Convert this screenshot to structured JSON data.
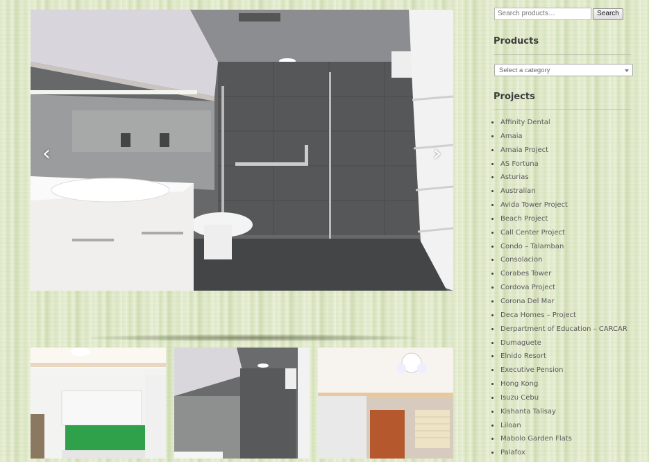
{
  "search": {
    "placeholder": "Search products…",
    "button_label": "Search"
  },
  "products_widget": {
    "title": "Products",
    "select_placeholder": "Select a category"
  },
  "projects_widget": {
    "title": "Projects",
    "items": [
      "Affinity Dental",
      "Amaia",
      "Amaia Project",
      "AS Fortuna",
      "Asturias",
      "Australian",
      "Avida Tower Project",
      "Beach Project",
      "Call Center Project",
      "Condo – Talamban",
      "Consolacion",
      "Corabes Tower",
      "Cordova Project",
      "Corona Del Mar",
      "Deca Homes – Project",
      "Derpartment of Education – CARCAR",
      "Dumaguete",
      "Elnido Resort",
      "Executive Pension",
      "Hong Kong",
      "Isuzu Cebu",
      "Kishanta Talisay",
      "Liloan",
      "Mabolo Garden Flats",
      "Palafox"
    ]
  },
  "slider": {
    "prev_icon": "chevron-left-icon",
    "next_icon": "chevron-right-icon"
  },
  "thumbnails": [
    "kitchen-photo",
    "bathroom-photo",
    "living-room-photo"
  ],
  "colors": {
    "background": "#dfe9c9",
    "text": "#5a5a5a",
    "heading": "#3c3c3c"
  }
}
